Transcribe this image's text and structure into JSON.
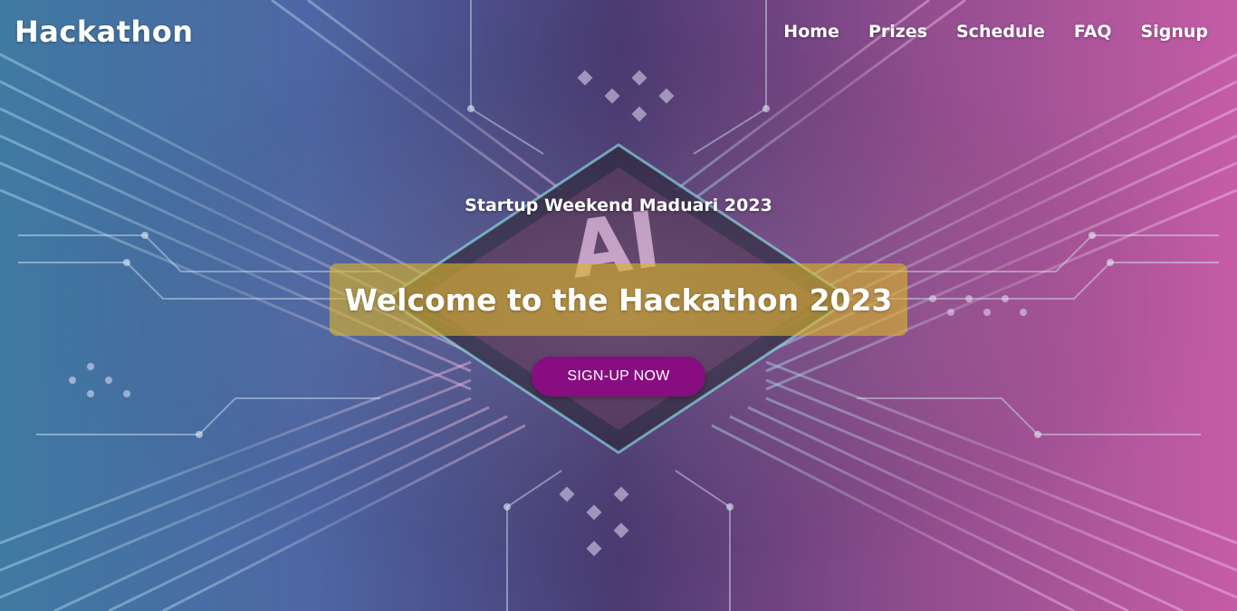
{
  "navbar": {
    "brand": "Hackathon",
    "links": [
      {
        "label": "Home"
      },
      {
        "label": "Prizes"
      },
      {
        "label": "Schedule"
      },
      {
        "label": "FAQ"
      },
      {
        "label": "Signup"
      }
    ]
  },
  "hero": {
    "background": "circuit-board-ai-chip-image",
    "chip_label": "AI",
    "subtitle": "Startup Weekend Maduari 2023",
    "title": "Welcome to the Hackathon 2023",
    "cta_label": "SIGN-UP NOW"
  },
  "colors": {
    "cta_background": "#880d80",
    "title_box": "#dcb428",
    "text": "#ffffff"
  }
}
